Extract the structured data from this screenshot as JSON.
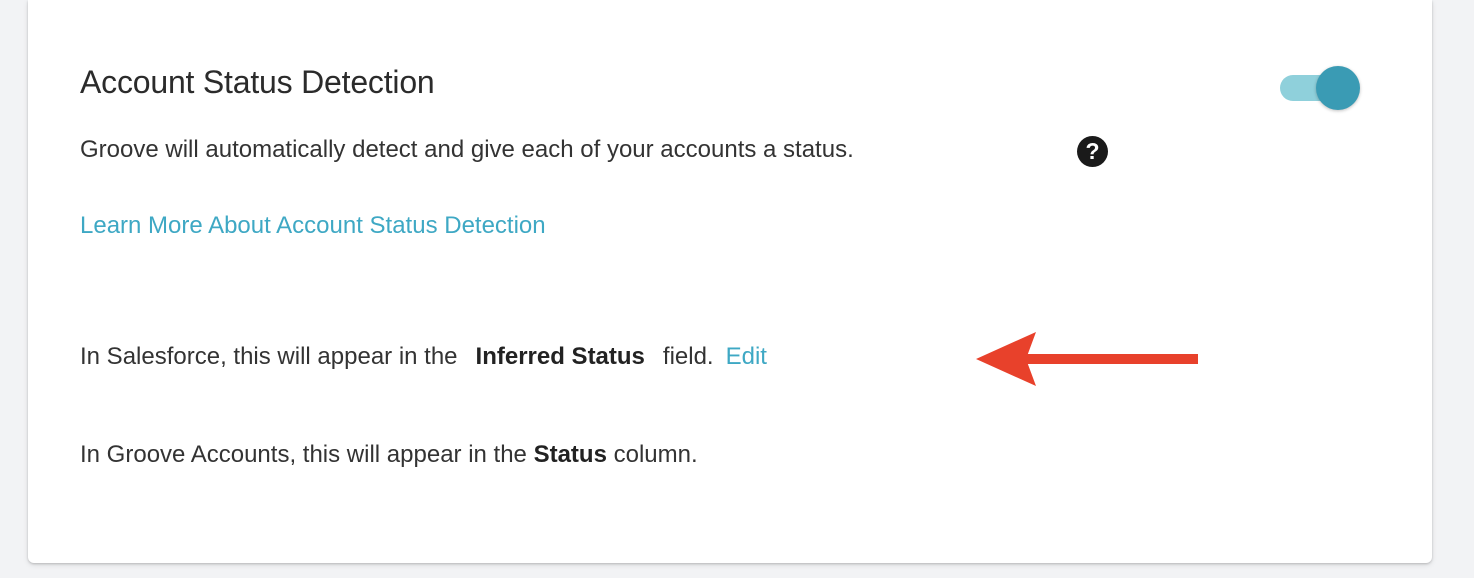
{
  "colors": {
    "accent": "#3ea8c4",
    "toggle_track": "#8fd0db",
    "toggle_knob": "#3a9bb4",
    "help_icon": "#1a1a1a",
    "arrow": "#e8412b"
  },
  "section": {
    "title": "Account Status Detection",
    "toggle_state": "on",
    "description": "Groove will automatically detect and give each of your accounts a status.",
    "help_icon_glyph": "?",
    "learn_more_label": "Learn More About Account Status Detection",
    "salesforce_line": {
      "prefix": "In Salesforce, this will appear in the",
      "field_name": "Inferred Status",
      "suffix": "field.",
      "edit_label": "Edit"
    },
    "groove_line": {
      "prefix": "In Groove Accounts, this will appear in the ",
      "column_name": "Status",
      "suffix": " column."
    }
  }
}
